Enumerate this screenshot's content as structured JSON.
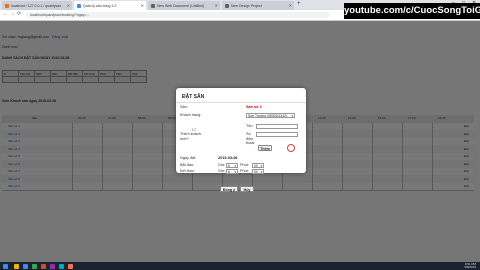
{
  "browser": {
    "tabs": [
      {
        "label": "localhost / 127.0.0.1 / quanlysan",
        "color": "#e8710a"
      },
      {
        "label": "Quản lý sân bóng 1.0",
        "color": "#4285f4"
      },
      {
        "label": "New Web Document (Untitled)",
        "color": "#5f6368"
      },
      {
        "label": "New Design Project",
        "color": "#5f6368"
      }
    ],
    "new_tab": "+",
    "url": "localhost/quanlysan/booking/?ngay=...",
    "back": "←",
    "forward": "→",
    "reload": "⟳",
    "win_min": "–",
    "win_max": "□",
    "win_close": "✕"
  },
  "watermark": "youtube.com/c/CuocSongToiGian",
  "page": {
    "user_line": "Xin chào: nvgiang@gmail.com",
    "logout": "Đăng xuất",
    "nav_label": "Danh mục",
    "list_title": "DANH SÁCH ĐẶT SÂN NGÀY 2019-03-08",
    "table_headers": [
      "#",
      "Tên KH",
      "SĐT",
      "Sân",
      "Bắt đầu",
      "Kết thúc",
      "Phút",
      "Tiền",
      "Xóa"
    ],
    "schedule_title": "Xem Khách sân ngày 2019-03-08",
    "schedule_header": [
      "Sân",
      "06:00",
      "07:00",
      "08:00",
      "09:00",
      "10:00",
      "11:00",
      "12:00",
      "13:00",
      "14:00",
      "15:00",
      "16:00",
      "17:00",
      "18:00"
    ],
    "fields": [
      "Sân số 1",
      "Sân số 2",
      "Sân số 3",
      "Sân số 4",
      "Sân số 5",
      "Sân số 6",
      "Sân số 7",
      "Sân số 8",
      "Sân số 9"
    ],
    "row_action": "Đặt"
  },
  "modal": {
    "title": "ĐẶT SÂN",
    "san_label": "Sân:",
    "san_value": "Sân số 3",
    "khach_label": "Khách hàng:",
    "khach_value": "Sơn Trường (0909111342)",
    "them_label": "Thêm khách mới?",
    "ten_label": "Tên:",
    "sdt_label": "Số điện thoại:",
    "them_btn": "Thêm",
    "ngay_label": "Ngày đặt:",
    "ngay_value": "2019-03-08",
    "batdau_label": "Bắt đầu:",
    "ketthuc_label": "Kết thúc:",
    "gio_label": "Giờ:",
    "phut_label": "Phút:",
    "gio_bd": "6",
    "phut_bd": "00",
    "gio_kt": "6",
    "phut_kt": "00",
    "dongy_btn": "Đồng ý",
    "huy_btn": "Hủy"
  },
  "taskbar": {
    "time": "9:51 PM",
    "date": "3/8/2019"
  }
}
